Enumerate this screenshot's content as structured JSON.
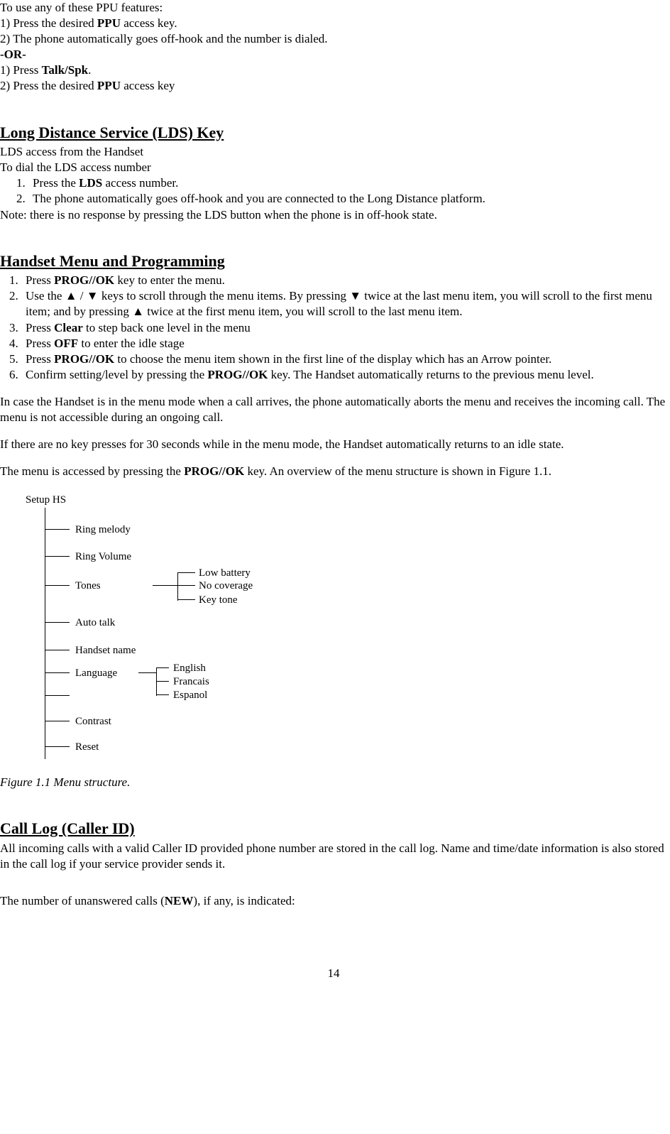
{
  "ppu": {
    "intro": "To use any of these PPU features:",
    "l1": "1) Press the desired ",
    "l1b": "PPU",
    "l1c": " access key.",
    "l2": "2) The phone automatically goes off-hook and the number is dialed.",
    "or": "-OR-",
    "l3a": "1) Press ",
    "l3b": "Talk/Spk",
    "l3c": ".",
    "l4a": "2) Press the desired ",
    "l4b": "PPU",
    "l4c": " access key"
  },
  "lds": {
    "title": "Long Distance Service (LDS) Key",
    "sub1": "LDS access from the Handset",
    "sub2": "To dial the LDS access number",
    "i1a": "Press the ",
    "i1b": "LDS",
    "i1c": " access number.",
    "i2": "The phone automatically goes off-hook and you are connected to the Long Distance platform.",
    "note": "Note: there is no response by pressing the LDS button when the phone is in off-hook state."
  },
  "menu": {
    "title": "Handset Menu and Programming",
    "i1a": "Press ",
    "i1b": "PROG//OK",
    "i1c": " key to enter the menu.",
    "i2": "Use the ▲ / ▼ keys to scroll through the menu items. By pressing ▼ twice at the last menu item, you will scroll to the first menu item; and by pressing ▲ twice at the first menu item, you will scroll to the last menu item.",
    "i3a": "Press ",
    "i3b": "Clear",
    "i3c": " to step back one level in the menu",
    "i4a": "Press ",
    "i4b": "OFF",
    "i4c": " to enter the idle stage",
    "i5a": "Press ",
    "i5b": "PROG//OK",
    "i5c": " to choose the menu item shown in the first line of the display which has an Arrow pointer.",
    "i6a": "Confirm setting/level by pressing the ",
    "i6b": "PROG//OK",
    "i6c": " key. The Handset automatically returns to the previous menu level.",
    "p1": "In case the Handset is in the menu mode when a call arrives, the phone automatically aborts the menu and receives the incoming call. The menu is not accessible during an ongoing call.",
    "p2": "If there are no key presses for 30 seconds while in the menu mode, the Handset automatically returns to an idle state.",
    "p3a": "The menu is accessed by pressing the ",
    "p3b": "PROG//OK",
    "p3c": " key. An overview of the menu structure is shown in Figure 1.1."
  },
  "tree": {
    "root": "Setup HS",
    "items": {
      "ring_melody": "Ring melody",
      "ring_volume": "Ring Volume",
      "tones": "Tones",
      "auto_talk": "Auto talk",
      "handset_name": "Handset name",
      "language": "Language",
      "contrast": "Contrast",
      "reset": "Reset"
    },
    "tones_sub": {
      "low": "Low battery",
      "no": "No coverage",
      "key": "Key tone"
    },
    "lang_sub": {
      "en": "English",
      "fr": "Francais",
      "es": "Espanol"
    }
  },
  "fig_caption": "Figure 1.1 Menu structure.",
  "calllog": {
    "title": "Call Log (Caller ID)",
    "p1": "All incoming calls with a valid Caller ID provided phone number are stored in the call log. Name and time/date information is also stored in the call log if your service provider sends it.",
    "p2a": "The number of unanswered calls (",
    "p2b": "NEW",
    "p2c": "), if any, is indicated:"
  },
  "pagenum": "14"
}
